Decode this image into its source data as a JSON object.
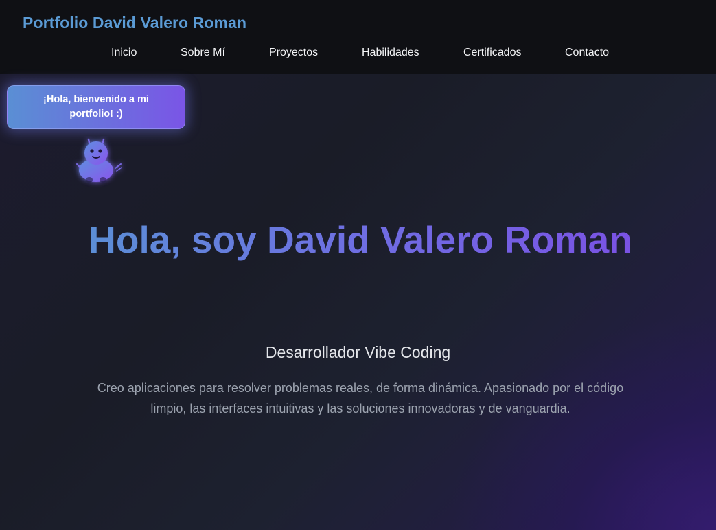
{
  "header": {
    "brand": "Portfolio David Valero Roman",
    "nav": [
      "Inicio",
      "Sobre Mí",
      "Proyectos",
      "Habilidades",
      "Certificados",
      "Contacto"
    ]
  },
  "mascot": {
    "bubble_text": "¡Hola, bienvenido a mi portfolio! :)",
    "icon": "robot-mascot-icon"
  },
  "hero": {
    "title": "Hola, soy David Valero Roman",
    "subtitle": "Desarrollador Vibe Coding",
    "description": "Creo aplicaciones para resolver problemas reales, de forma dinámica. Apasionado por el código limpio, las interfaces intuitivas y las soluciones innovadoras y de vanguardia."
  },
  "colors": {
    "brand": "#5b9bd5",
    "accent_start": "#5b8fd6",
    "accent_end": "#7a52e4",
    "background": "#0f1014"
  }
}
